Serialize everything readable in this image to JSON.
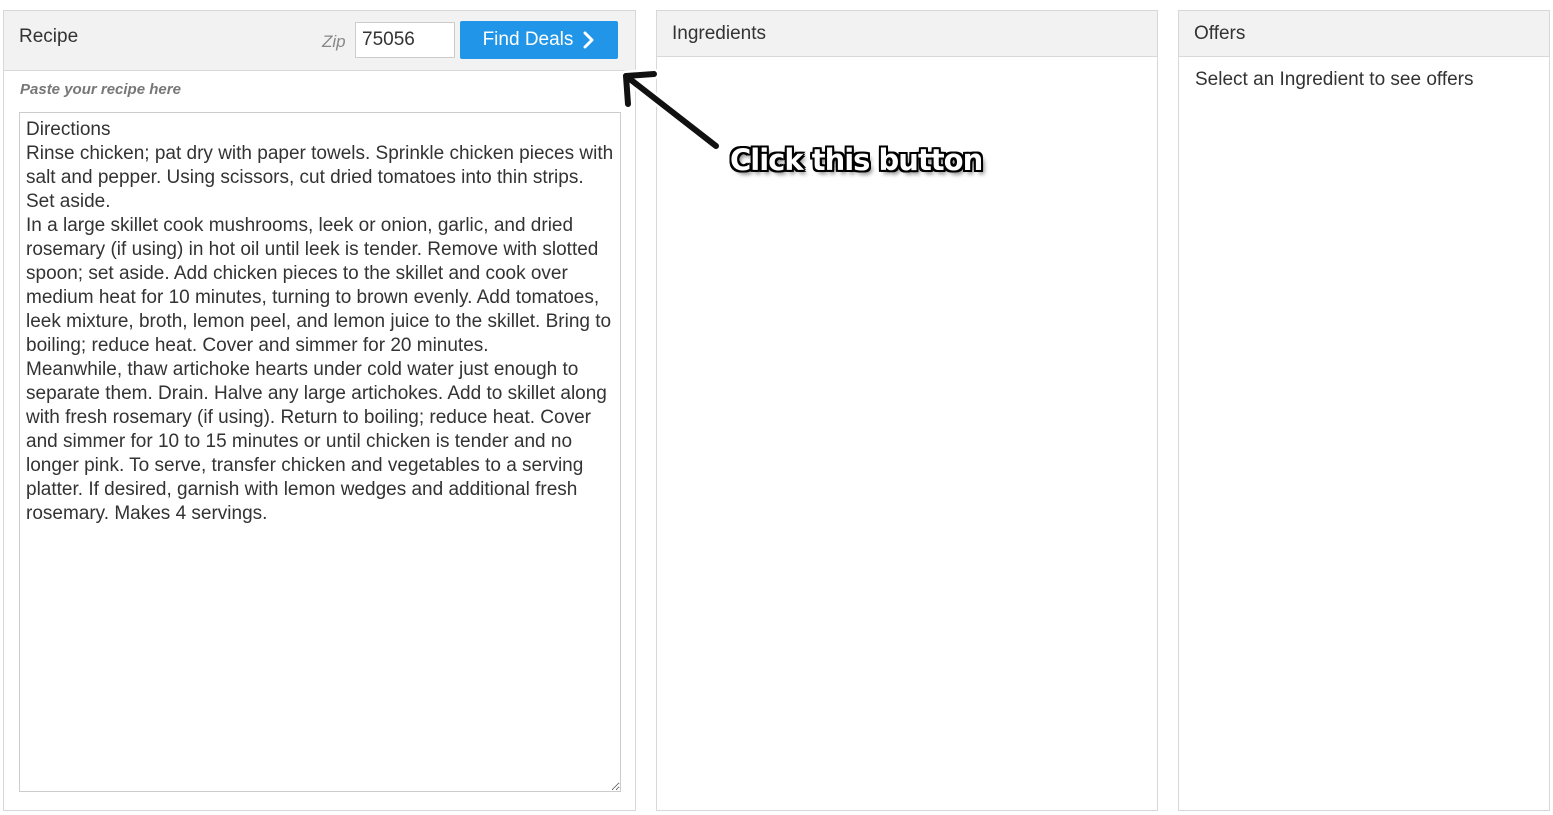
{
  "recipe_panel": {
    "title": "Recipe",
    "zip_label": "Zip",
    "zip_value": "75056",
    "find_deals_label": "Find Deals",
    "paste_hint": "Paste your recipe here",
    "recipe_text": "Directions\nRinse chicken; pat dry with paper towels. Sprinkle chicken pieces with salt and pepper. Using scissors, cut dried tomatoes into thin strips. Set aside.\nIn a large skillet cook mushrooms, leek or onion, garlic, and dried rosemary (if using) in hot oil until leek is tender. Remove with slotted spoon; set aside. Add chicken pieces to the skillet and cook over medium heat for 10 minutes, turning to brown evenly. Add tomatoes, leek mixture, broth, lemon peel, and lemon juice to the skillet. Bring to boiling; reduce heat. Cover and simmer for 20 minutes.\nMeanwhile, thaw artichoke hearts under cold water just enough to separate them. Drain. Halve any large artichokes. Add to skillet along with fresh rosemary (if using). Return to boiling; reduce heat. Cover and simmer for 10 to 15 minutes or until chicken is tender and no longer pink. To serve, transfer chicken and vegetables to a serving platter. If desired, garnish with lemon wedges and additional fresh rosemary. Makes 4 servings."
  },
  "ingredients_panel": {
    "title": "Ingredients"
  },
  "offers_panel": {
    "title": "Offers",
    "empty_text": "Select an Ingredient to see offers"
  },
  "annotation": {
    "label": "Click this button",
    "arrow_icon": "arrow-up-left-icon"
  },
  "icons": {
    "find_deals_icon": "chevron-right-icon"
  },
  "colors": {
    "accent": "#2196e8",
    "panel_header_bg": "#f2f2f2",
    "border": "#d8d8d8"
  }
}
